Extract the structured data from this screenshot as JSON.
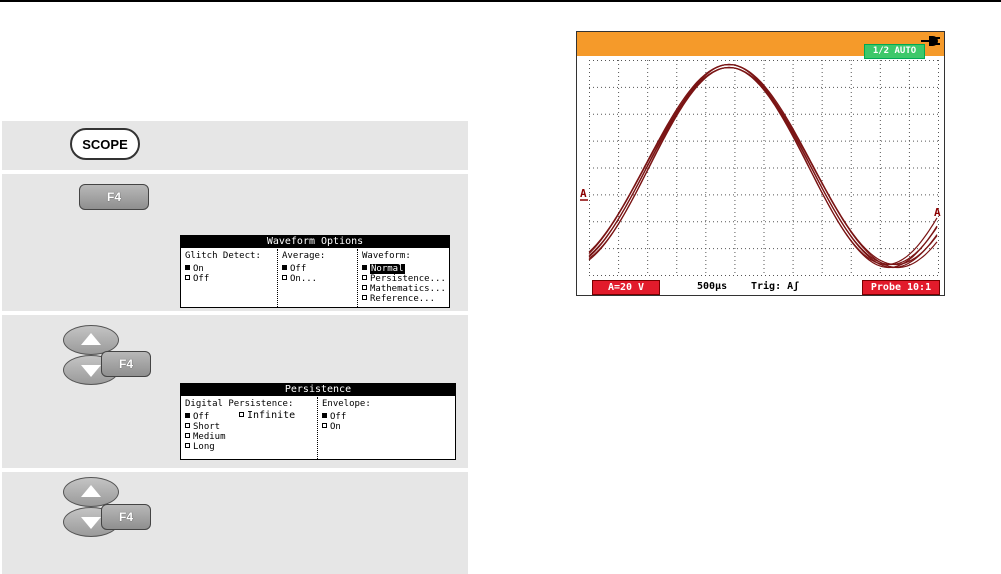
{
  "steps": {
    "step1": {
      "key": "SCOPE"
    },
    "step2": {
      "key": "F4",
      "menu": {
        "title": "Waveform Options",
        "col1": {
          "header": "Glitch Detect:",
          "options": [
            "On",
            "Off"
          ]
        },
        "col2": {
          "header": "Average:",
          "options": [
            "Off",
            "On..."
          ]
        },
        "col3": {
          "header": "Waveform:",
          "options": [
            "Normal",
            "Persistence...",
            "Mathematics...",
            "Reference..."
          ]
        }
      }
    },
    "step3": {
      "key": "F4",
      "menu": {
        "title": "Persistence",
        "col1": {
          "header": "Digital Persistence:",
          "options": [
            "Off",
            "Short",
            "Medium",
            "Long",
            "Infinite"
          ]
        },
        "col2": {
          "header": "Envelope:",
          "options": [
            "Off",
            "On"
          ]
        }
      }
    },
    "step4": {
      "key": "F4"
    }
  },
  "scope_screen": {
    "mode_badge": "1/2 AUTO",
    "channel_marker": "A",
    "channel_scale": "A=20 V",
    "timebase": "500µs",
    "trigger": "Trig: Aʃ",
    "probe": "Probe 10:1",
    "colors": {
      "header": "#f59a2a",
      "badge": "#3dc86a",
      "trace": "#7a1414",
      "status": "#e21b2b"
    }
  }
}
